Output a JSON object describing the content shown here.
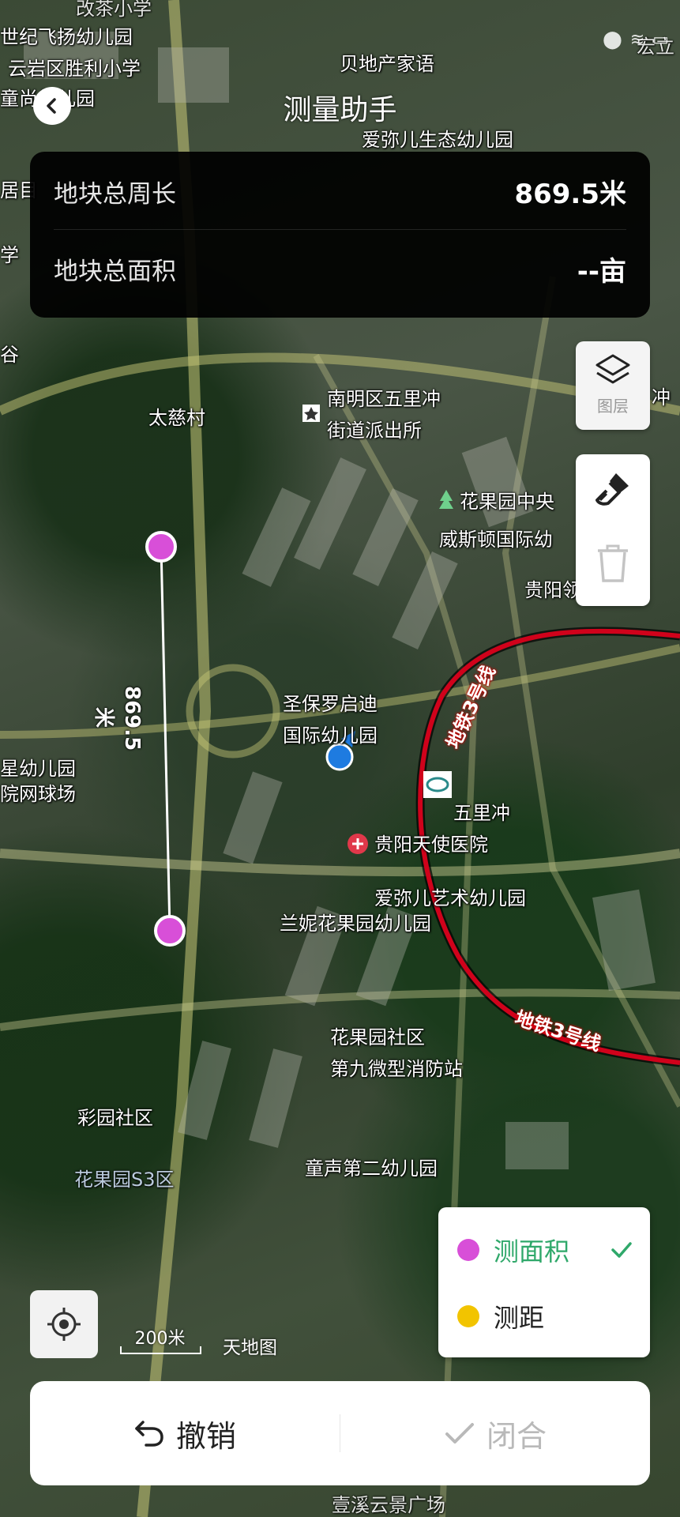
{
  "header": {
    "title": "测量助手"
  },
  "stats": {
    "perimeter_label": "地块总周长",
    "perimeter_value": "869.5米",
    "area_label": "地块总面积",
    "area_value": "--亩"
  },
  "tools": {
    "layers_label": "图层"
  },
  "measure": {
    "segment_label": "869.5米"
  },
  "modes": [
    {
      "label": "测面积",
      "color": "#d84fd8",
      "selected": true
    },
    {
      "label": "测距",
      "color": "#f2c400",
      "selected": false
    }
  ],
  "map": {
    "scale_label": "200米",
    "source_label": "天地图",
    "labels": {
      "p1": "改茶小学",
      "p2": "世纪飞扬幼儿园",
      "p3": "云岩区胜利小学",
      "p4": "童尚幼儿园",
      "p5": "贝地产家语",
      "p6": "爱弥儿生态幼儿园",
      "p7": "居目",
      "p8": "学",
      "p9": "谷",
      "p10": "太慈村",
      "p11": "南明区五里冲",
      "p12": "街道派出所",
      "p13": "花果园中央",
      "p14": "威斯顿国际幼",
      "p15": "贵阳领",
      "p16": "冲",
      "p17": "圣保罗启迪",
      "p18": "国际幼儿园",
      "p19": "五里冲",
      "p20": "贵阳天使医院",
      "p21": "星幼儿园",
      "p22": "院网球场",
      "p23": "爱弥儿艺术幼儿园",
      "p24": "兰妮花果园幼儿园",
      "p25": "花果园社区",
      "p26": "第九微型消防站",
      "p27": "彩园社区",
      "p28": "花果园S3区",
      "p29": "童声第二幼儿园",
      "p30": "地铁3号线",
      "p31": "地铁3号线",
      "p32": "壹溪云景广场",
      "p33": "宏立"
    }
  },
  "actions": {
    "undo_label": "撤销",
    "close_label": "闭合"
  },
  "colors": {
    "accent_green": "#2fa86a",
    "vertex_magenta": "#d84fd8",
    "location_blue": "#1e7be0",
    "metro_red": "#d0021b"
  }
}
